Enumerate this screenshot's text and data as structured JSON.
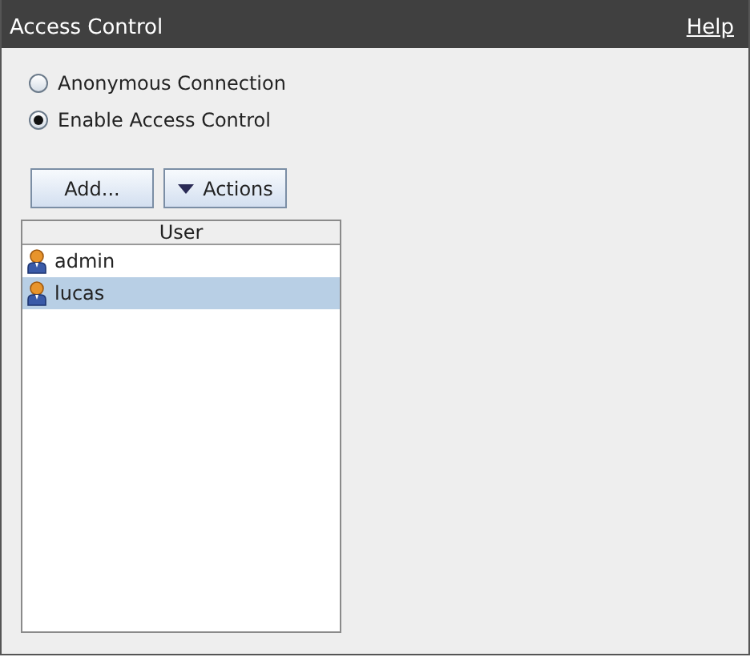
{
  "window": {
    "title": "Access Control",
    "help": "Help"
  },
  "radios": [
    {
      "label": "Anonymous Connection",
      "selected": false
    },
    {
      "label": "Enable Access Control",
      "selected": true
    }
  ],
  "buttons": [
    {
      "label": "Add...",
      "kind": "plain"
    },
    {
      "label": "Actions",
      "kind": "menu"
    }
  ],
  "table": {
    "columns": [
      "User"
    ],
    "rows": [
      {
        "name": "admin",
        "selected": false
      },
      {
        "name": "lucas",
        "selected": true
      }
    ]
  }
}
